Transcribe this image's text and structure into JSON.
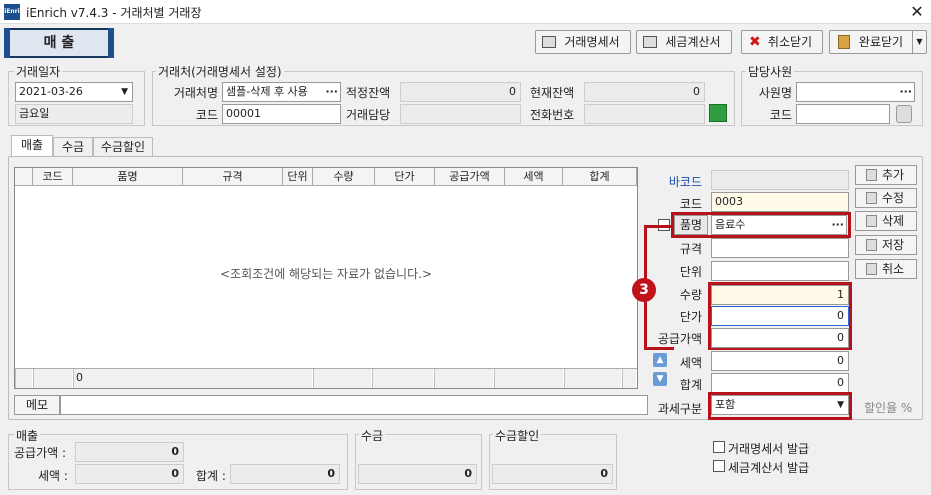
{
  "window": {
    "title": "iEnrich v7.4.3 - 거래처별 거래장",
    "logo_text": "iEnri",
    "close": "✕"
  },
  "main_tab": "매 출",
  "toolbar": {
    "statement": "거래명세서",
    "tax_invoice": "세금계산서",
    "cancel_close": "취소닫기",
    "complete_close": "완료닫기"
  },
  "date_group": {
    "title": "거래일자",
    "date": "2021-03-26",
    "weekday": "금요일"
  },
  "client_group": {
    "title": "거래처(거래명세서 설정)",
    "name_label": "거래처명",
    "name_value": "샘플-삭제 후 사용",
    "code_label": "코드",
    "code_value": "00001",
    "balance_label": "적정잔액",
    "balance_value": "0",
    "current_label": "현재잔액",
    "current_value": "0",
    "manager_label": "거래담당",
    "manager_value": "",
    "phone_label": "전화번호",
    "phone_value": ""
  },
  "staff_group": {
    "title": "담당사원",
    "name_label": "사원명",
    "name_value": "",
    "code_label": "코드",
    "code_value": ""
  },
  "tabs": [
    "매출",
    "수금",
    "수금할인"
  ],
  "grid": {
    "columns": [
      "코드",
      "품명",
      "규격",
      "단위",
      "수량",
      "단가",
      "공급가액",
      "세액",
      "합계"
    ],
    "empty_message": "<조회조건에 해당되는 자료가 없습니다.>",
    "footer_count": "0"
  },
  "memo_label": "메모",
  "detail": {
    "barcode_label": "바코드",
    "barcode_value": "",
    "code_label": "코드",
    "code_value": "0003",
    "item_label": "품명",
    "item_value": "음료수",
    "spec_label": "규격",
    "spec_value": "",
    "unit_label": "단위",
    "unit_value": "",
    "qty_label": "수량",
    "qty_value": "1",
    "price_label": "단가",
    "price_value": "0",
    "supply_label": "공급가액",
    "supply_value": "0",
    "tax_label": "세액",
    "tax_value": "0",
    "total_label": "합계",
    "total_value": "0",
    "taxtype_label": "과세구분",
    "taxtype_value": "포함",
    "discount_label": "할인율 %"
  },
  "side_buttons": [
    "추가",
    "수정",
    "삭제",
    "저장",
    "취소"
  ],
  "badge": "3",
  "summary": {
    "sales_title": "매출",
    "supply_label": "공급가액 :",
    "supply_value": "0",
    "tax_label": "세액 :",
    "tax_value": "0",
    "total_label": "합계 :",
    "total_value": "0",
    "collect_title": "수금",
    "collect_value": "0",
    "discount_title": "수금할인",
    "discount_value": "0"
  },
  "checks": {
    "statement": "거래명세서 발급",
    "tax_invoice": "세금계산서 발급"
  },
  "colors": {
    "accent": "#1f4e8c",
    "highlight": "#b5121b"
  }
}
